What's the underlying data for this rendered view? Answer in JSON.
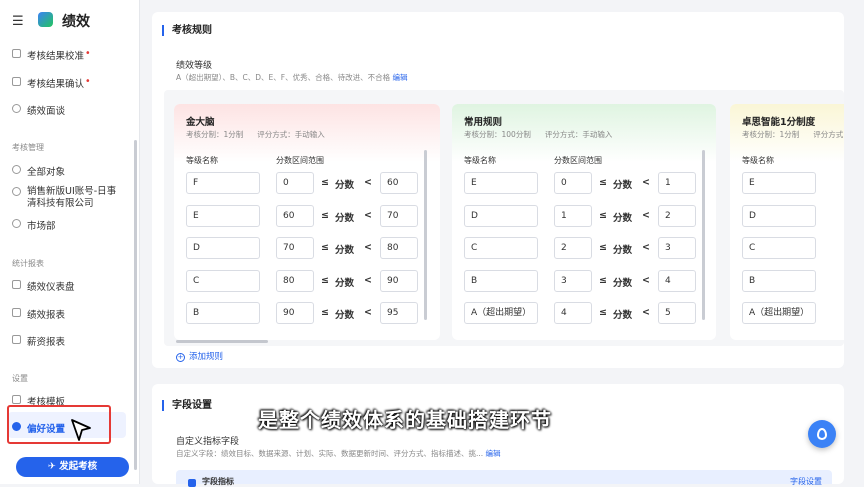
{
  "app": {
    "title": "绩效"
  },
  "sidebar": {
    "items_top": [
      {
        "label": "考核结果校准",
        "dot": "•"
      },
      {
        "label": "考核结果确认",
        "dot": "•"
      },
      {
        "label": "绩效面谈"
      }
    ],
    "section_manage": "考核管理",
    "manage_items": [
      "全部对象",
      "销售新版UI账号-日事清科技有限公司",
      "市场部"
    ],
    "section_report": "统计报表",
    "report_items": [
      "绩效仪表盘",
      "绩效报表",
      "薪资报表"
    ],
    "section_settings": "设置",
    "settings_items": [
      "考核模板",
      "偏好设置"
    ],
    "launch_button": "发起考核"
  },
  "rules": {
    "title": "考核规则",
    "grade_title": "绩效等级",
    "grade_desc": "A（超出期望）、B、C、D、E、F、优秀、合格、待改进、不合格",
    "edit": "编辑",
    "col_grade": "等级名称",
    "col_range": "分数区间范围",
    "leq": "≤",
    "score": "分数",
    "lt": "<",
    "add_rule": "添加规则",
    "cards": [
      {
        "name": "金大脑",
        "split": "考核分制：1分制",
        "method": "评分方式：手动输入",
        "rows": [
          {
            "grade": "F",
            "min": "0",
            "max": "60"
          },
          {
            "grade": "E",
            "min": "60",
            "max": "70"
          },
          {
            "grade": "D",
            "min": "70",
            "max": "80"
          },
          {
            "grade": "C",
            "min": "80",
            "max": "90"
          },
          {
            "grade": "B",
            "min": "90",
            "max": "95"
          }
        ]
      },
      {
        "name": "常用规则",
        "split": "考核分制：100分制",
        "method": "评分方式：手动输入",
        "rows": [
          {
            "grade": "E",
            "min": "0",
            "max": "1"
          },
          {
            "grade": "D",
            "min": "1",
            "max": "2"
          },
          {
            "grade": "C",
            "min": "2",
            "max": "3"
          },
          {
            "grade": "B",
            "min": "3",
            "max": "4"
          },
          {
            "grade": "A（超出期望）",
            "min": "4",
            "max": "5"
          }
        ]
      },
      {
        "name": "卓思智能1分制度",
        "split": "考核分制：1分制",
        "method": "评分方式",
        "rows": [
          {
            "grade": "E"
          },
          {
            "grade": "D"
          },
          {
            "grade": "C"
          },
          {
            "grade": "B"
          },
          {
            "grade": "A（超出期望）"
          }
        ]
      }
    ]
  },
  "fields": {
    "title": "字段设置",
    "custom_title": "自定义指标字段",
    "custom_desc": "自定义字段：绩效目标、数据来源、计划、实际、数据更新时间、评分方式、指标描述、挑...",
    "edit": "编辑",
    "strip_text": "字段指标",
    "strip_right": "字段设置"
  },
  "subtitle": "是整个绩效体系的基础搭建环节",
  "colors": {
    "accent": "#2563eb",
    "card1_head": "#fde7e7",
    "card2_head": "#e3f6e4",
    "card3_head": "#fbf8dc"
  }
}
